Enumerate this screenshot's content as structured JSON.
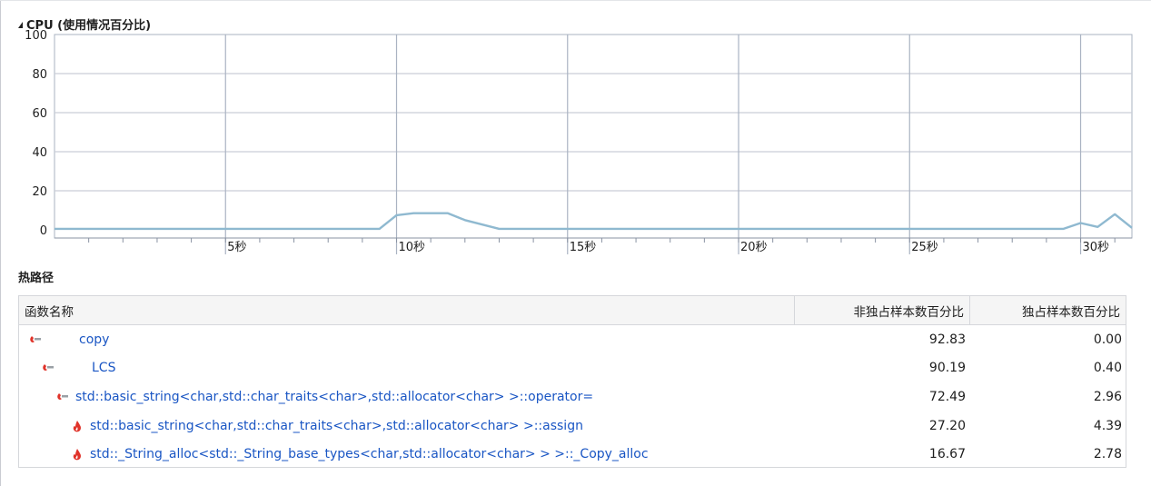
{
  "cpu_section": {
    "title": "CPU (使用情况百分比)"
  },
  "chart_data": {
    "type": "line",
    "title": "CPU (使用情况百分比)",
    "xlabel": "",
    "ylabel": "",
    "y_ticks": [
      "100",
      "80",
      "60",
      "40",
      "20",
      "0"
    ],
    "x_ticks": [
      "5秒",
      "10秒",
      "15秒",
      "20秒",
      "25秒",
      "30秒"
    ],
    "ylim": [
      0,
      100
    ],
    "xlim": [
      0,
      31.5
    ],
    "grid": true,
    "line_color": "#8fb9d0",
    "series": [
      {
        "x": [
          0,
          1,
          2,
          3,
          4,
          5,
          6,
          7,
          8,
          9,
          9.5,
          10,
          10.5,
          11,
          11.5,
          12,
          13,
          14,
          15,
          16,
          17,
          18,
          19,
          20,
          21,
          22,
          23,
          24,
          25,
          26,
          27,
          28,
          29,
          29.5,
          30,
          30.5,
          31,
          31.5
        ],
        "y": [
          0.5,
          0.5,
          0.5,
          0.5,
          0.5,
          0.5,
          0.5,
          0.5,
          0.5,
          0.5,
          0.5,
          7.5,
          8.5,
          8.5,
          8.5,
          5,
          0.5,
          0.5,
          0.5,
          0.5,
          0.5,
          0.5,
          0.5,
          0.5,
          0.5,
          0.5,
          0.5,
          0.5,
          0.5,
          0.5,
          0.5,
          0.5,
          0.5,
          0.5,
          3.5,
          1.5,
          8,
          1
        ]
      }
    ]
  },
  "hot_path": {
    "title": "热路径",
    "columns": {
      "name": "函数名称",
      "inclusive": "非独占样本数百分比",
      "exclusive": "独占样本数百分比"
    },
    "rows": [
      {
        "icon": "hot-path-arrow-icon",
        "name": "copy",
        "inclusive": "92.83",
        "exclusive": "0.00"
      },
      {
        "icon": "hot-path-arrow-icon",
        "name": "LCS",
        "inclusive": "90.19",
        "exclusive": "0.40"
      },
      {
        "icon": "hot-path-arrow-icon",
        "name": "std::basic_string<char,std::char_traits<char>,std::allocator<char> >::operator=",
        "inclusive": "72.49",
        "exclusive": "2.96"
      },
      {
        "icon": "flame-icon",
        "name": "std::basic_string<char,std::char_traits<char>,std::allocator<char> >::assign",
        "inclusive": "27.20",
        "exclusive": "4.39"
      },
      {
        "icon": "flame-icon",
        "name": "std::_String_alloc<std::_String_base_types<char,std::allocator<char> > >::_Copy_alloc",
        "inclusive": "16.67",
        "exclusive": "2.78"
      }
    ]
  }
}
